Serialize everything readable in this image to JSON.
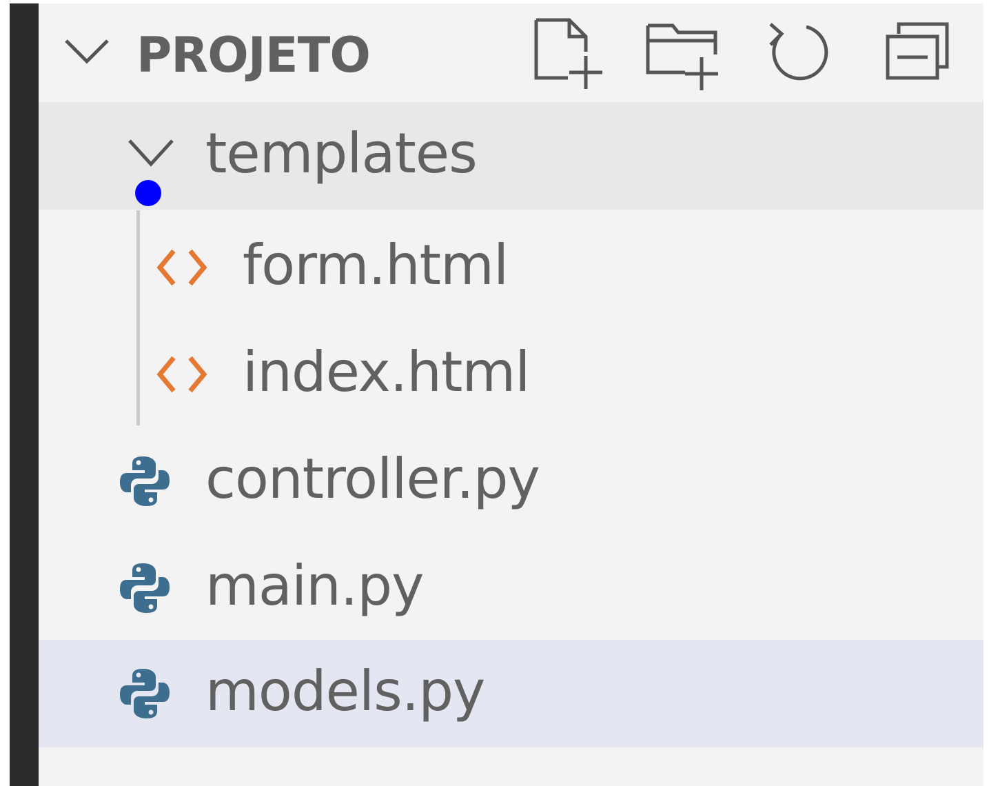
{
  "explorer": {
    "section_title": "PROJETO",
    "actions": [
      {
        "name": "new-file-icon"
      },
      {
        "name": "new-folder-icon"
      },
      {
        "name": "refresh-icon"
      },
      {
        "name": "collapse-all-icon"
      }
    ],
    "folder": {
      "label": "templates",
      "expanded": true
    },
    "files": {
      "form": "form.html",
      "index": "index.html",
      "controller": "controller.py",
      "main": "main.py",
      "models": "models.py"
    },
    "selected": "models.py"
  },
  "colors": {
    "sidebar_bg": "#f3f3f3",
    "hover_row": "#e8e8e8",
    "selected_row": "#e4e6f1",
    "text": "#616161",
    "html_icon": "#e37933",
    "python_icon": "#3d6e8f",
    "drag_dot": "#0000ff"
  }
}
